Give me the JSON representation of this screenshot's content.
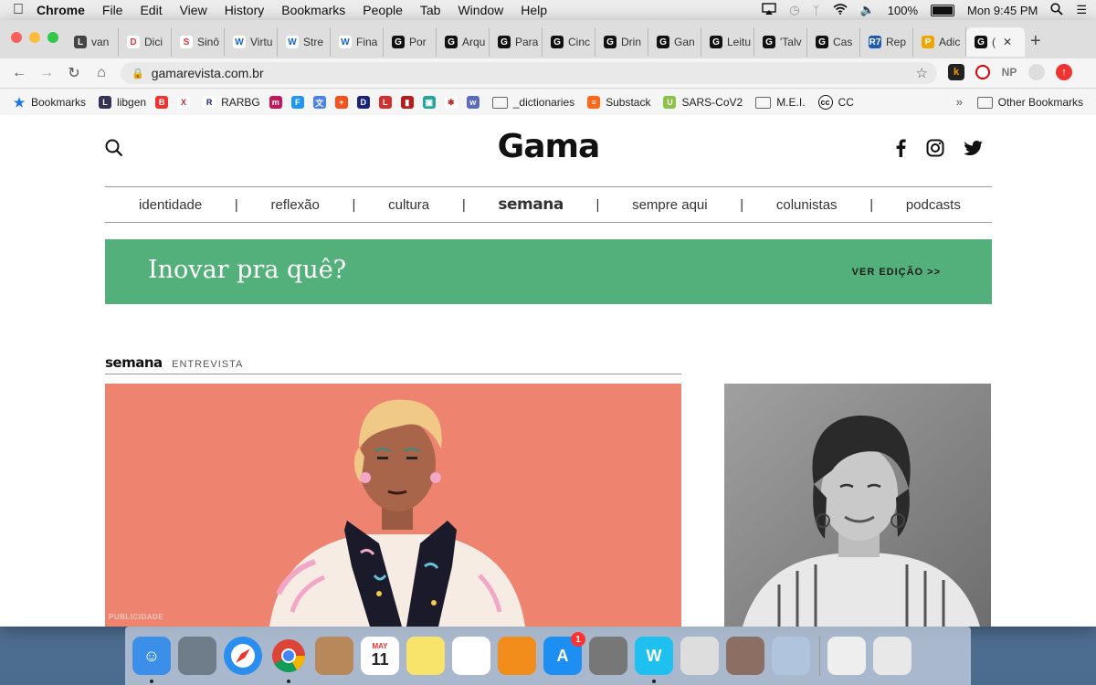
{
  "menubar": {
    "app": "Chrome",
    "items": [
      "File",
      "Edit",
      "View",
      "History",
      "Bookmarks",
      "People",
      "Tab",
      "Window",
      "Help"
    ],
    "battery": "100%",
    "clock": "Mon 9:45 PM"
  },
  "tabs": [
    {
      "label": "van",
      "icon": "lib-icon",
      "bg": "#444",
      "glyph": "L"
    },
    {
      "label": "Dici",
      "icon": "idict-icon",
      "bg": "#fff",
      "glyph": "D"
    },
    {
      "label": "Sinô",
      "icon": "substack-s-icon",
      "bg": "#fff",
      "glyph": "S"
    },
    {
      "label": "Virtu",
      "icon": "iw-icon",
      "bg": "#fff",
      "glyph": "W"
    },
    {
      "label": "Stre",
      "icon": "iw-icon",
      "bg": "#fff",
      "glyph": "W"
    },
    {
      "label": "Fina",
      "icon": "iw-icon",
      "bg": "#fff",
      "glyph": "W"
    },
    {
      "label": "Por",
      "icon": "gama-g-icon",
      "bg": "#111",
      "glyph": "G"
    },
    {
      "label": "Arqu",
      "icon": "gama-g-icon",
      "bg": "#111",
      "glyph": "G"
    },
    {
      "label": "Para",
      "icon": "gama-g-icon",
      "bg": "#111",
      "glyph": "G"
    },
    {
      "label": "Cinc",
      "icon": "gama-g-icon",
      "bg": "#111",
      "glyph": "G"
    },
    {
      "label": "Drin",
      "icon": "gama-g-icon",
      "bg": "#111",
      "glyph": "G"
    },
    {
      "label": "Gan",
      "icon": "gama-g-icon",
      "bg": "#111",
      "glyph": "G"
    },
    {
      "label": "Leitu",
      "icon": "gama-g-icon",
      "bg": "#111",
      "glyph": "G"
    },
    {
      "label": "'Talv",
      "icon": "gama-g-icon",
      "bg": "#111",
      "glyph": "G"
    },
    {
      "label": "Cas",
      "icon": "gama-g-icon",
      "bg": "#111",
      "glyph": "G"
    },
    {
      "label": "Rep",
      "icon": "r7-icon",
      "bg": "#1e5bb8",
      "glyph": "R7"
    },
    {
      "label": "Adic",
      "icon": "ip-icon",
      "bg": "#f0a500",
      "glyph": "P"
    },
    {
      "label": "(",
      "icon": "gama-g-icon",
      "bg": "#111",
      "glyph": "G",
      "active": true
    }
  ],
  "address": {
    "url": "gamarevista.com.br"
  },
  "bookmarks": [
    {
      "label": "Bookmarks",
      "icon": "star-icon",
      "bg": "#1a73e8",
      "glyph": "★"
    },
    {
      "label": "libgen",
      "icon": "libgen-icon",
      "bg": "#335",
      "glyph": "L"
    },
    {
      "label": "",
      "icon": "bit-icon",
      "bg": "#e33",
      "glyph": "B"
    },
    {
      "label": "",
      "icon": "x-icon",
      "bg": "#fff",
      "glyph": "X"
    },
    {
      "label": "RARBG",
      "icon": "r-icon",
      "bg": "#fff",
      "glyph": "R"
    },
    {
      "label": "",
      "icon": "m-icon",
      "bg": "#c2185b",
      "glyph": "m"
    },
    {
      "label": "",
      "icon": "f-icon",
      "bg": "#2196f3",
      "glyph": "F"
    },
    {
      "label": "",
      "icon": "translate-icon",
      "bg": "#4a80f0",
      "glyph": "文"
    },
    {
      "label": "",
      "icon": "plus-icon",
      "bg": "#f4511e",
      "glyph": "+"
    },
    {
      "label": "",
      "icon": "dfy-icon",
      "bg": "#1a237e",
      "glyph": "D"
    },
    {
      "label": "",
      "icon": "l-icon",
      "bg": "#d32f2f",
      "glyph": "L"
    },
    {
      "label": "",
      "icon": "bookmark-red-icon",
      "bg": "#b71c1c",
      "glyph": "▮"
    },
    {
      "label": "",
      "icon": "image-icon",
      "bg": "#26a69a",
      "glyph": "▣"
    },
    {
      "label": "",
      "icon": "dots-icon",
      "bg": "#fff",
      "glyph": "✱"
    },
    {
      "label": "",
      "icon": "w-icon",
      "bg": "#5c6bc0",
      "glyph": "w"
    },
    {
      "label": "_dictionaries",
      "icon": "folder-icon",
      "bg": "",
      "glyph": ""
    },
    {
      "label": "Substack",
      "icon": "substack-icon",
      "bg": "#ff6719",
      "glyph": "≡"
    },
    {
      "label": "SARS-CoV2",
      "icon": "u-icon",
      "bg": "#8bc34a",
      "glyph": "U"
    },
    {
      "label": "M.E.I.",
      "icon": "folder-icon",
      "bg": "",
      "glyph": ""
    },
    {
      "label": "CC",
      "icon": "cc-icon",
      "bg": "#fff",
      "glyph": "cc"
    }
  ],
  "other_bookmarks": "Other Bookmarks",
  "chevron": "»",
  "site": {
    "logo": "Gama",
    "nav": [
      "identidade",
      "reflexão",
      "cultura",
      "semana",
      "sempre aqui",
      "colunistas",
      "podcasts"
    ],
    "separator": "|",
    "banner_title": "Inovar pra quê?",
    "banner_link": "VER EDIÇÃO >>",
    "section_brand": "semana",
    "section_label": "ENTREVISTA",
    "ad_label": "PUBLICIDADE"
  },
  "dock": {
    "apps": [
      {
        "icon": "finder-icon",
        "bg": "#3b8fe8",
        "running": true
      },
      {
        "icon": "launchpad-icon",
        "bg": "#6f7c8a"
      },
      {
        "icon": "safari-icon",
        "bg": "#2a8df0"
      },
      {
        "icon": "chrome-icon",
        "bg": "#fff",
        "running": true
      },
      {
        "icon": "contacts-icon",
        "bg": "#b8885a"
      },
      {
        "icon": "calendar-icon",
        "bg": "#fff",
        "text": "11"
      },
      {
        "icon": "notes-icon",
        "bg": "#f8e36b"
      },
      {
        "icon": "photos-icon",
        "bg": "#fff"
      },
      {
        "icon": "books-icon",
        "bg": "#f28c1b"
      },
      {
        "icon": "app-store-icon",
        "bg": "#1d8ef2",
        "badge": "1"
      },
      {
        "icon": "system-preferences-icon",
        "bg": "#777"
      },
      {
        "icon": "word-w-icon",
        "bg": "#1ec0ef",
        "running": true
      },
      {
        "icon": "alfred-icon",
        "bg": "#ddd"
      },
      {
        "icon": "library-icon",
        "bg": "#8d6e63"
      },
      {
        "icon": "preview-icon",
        "bg": "#b0c4de"
      }
    ],
    "right": [
      {
        "icon": "downloads-stack-icon",
        "bg": "#eee"
      },
      {
        "icon": "trash-icon",
        "bg": "#e8e8e8"
      }
    ],
    "calendar_month": "MAY"
  }
}
